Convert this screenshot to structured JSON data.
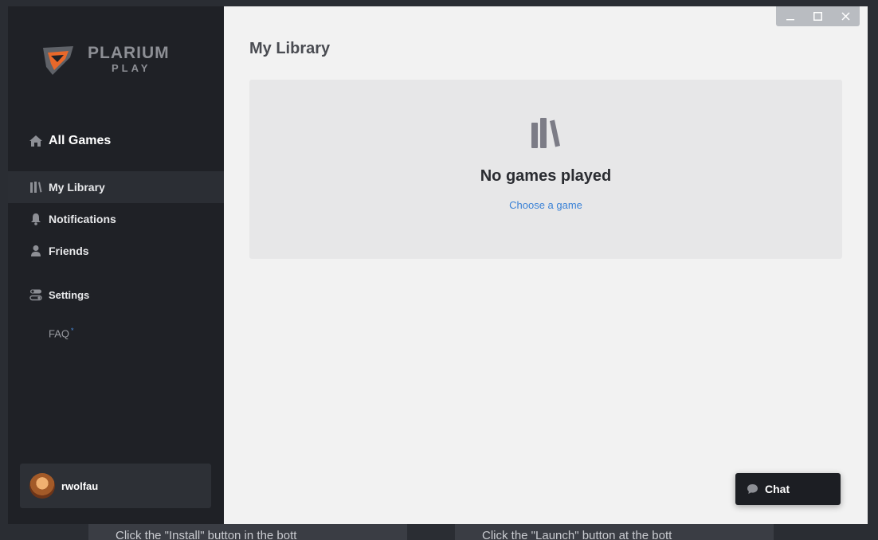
{
  "app": {
    "brand_line1": "PLARIUM",
    "brand_line2": "PLAY"
  },
  "sidebar": {
    "all_games": {
      "label": "All Games",
      "icon": "home-icon"
    },
    "items": [
      {
        "label": "My Library",
        "icon": "library-icon",
        "active": true
      },
      {
        "label": "Notifications",
        "icon": "bell-icon"
      },
      {
        "label": "Friends",
        "icon": "person-icon"
      },
      {
        "label": "Settings",
        "icon": "toggle-icon"
      }
    ],
    "faq": {
      "label": "FAQ",
      "mark": "*"
    }
  },
  "user": {
    "name": "rwolfau"
  },
  "main": {
    "title": "My Library",
    "empty": {
      "title": "No games played",
      "link": "Choose a game"
    }
  },
  "chat": {
    "label": "Chat"
  },
  "colors": {
    "sidebar": "#1f2126",
    "accent_link": "#3b82d6",
    "logo_orange": "#e8682a"
  }
}
